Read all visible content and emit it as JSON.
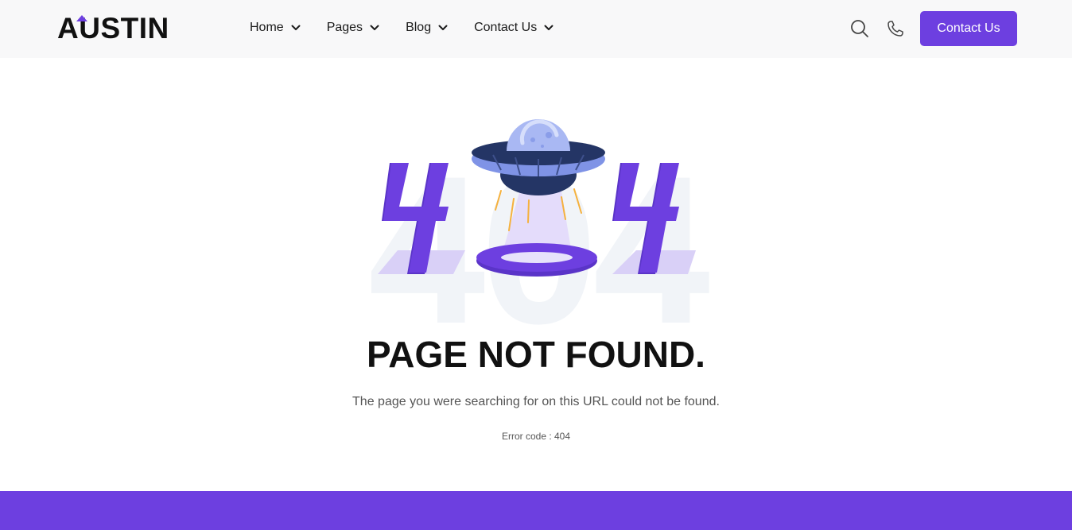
{
  "header": {
    "logo": "AUSTIN",
    "nav": [
      {
        "label": "Home"
      },
      {
        "label": "Pages"
      },
      {
        "label": "Blog"
      },
      {
        "label": "Contact Us"
      }
    ],
    "icons": [
      "search-icon",
      "phone-icon",
      "chevron-down-icon"
    ],
    "cta_label": "Contact Us"
  },
  "main": {
    "background_text": "404",
    "title": "PAGE NOT FOUND.",
    "subtitle": "The page you were searching for on this URL could not be found.",
    "error_code": "Error code : 404"
  },
  "colors": {
    "accent": "#6d3fe0",
    "header_bg": "#f8f8f9",
    "text_dark": "#111111",
    "text_muted": "#555555"
  }
}
